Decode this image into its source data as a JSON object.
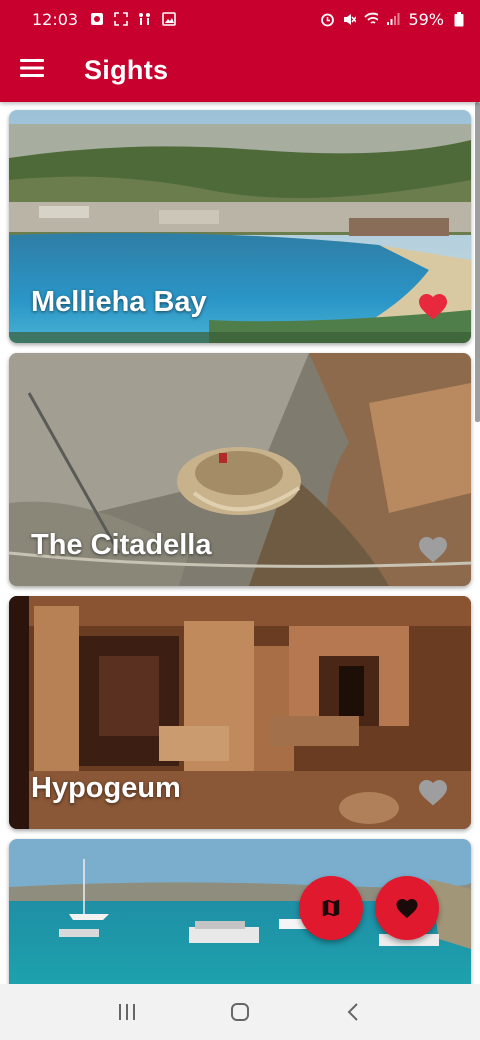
{
  "status_bar": {
    "time": "12:03",
    "battery": "59%",
    "left_icons": [
      "notification-icon",
      "screenshot-icon",
      "accessibility-icon",
      "gallery-icon"
    ],
    "right_icons": [
      "alarm-icon",
      "mute-icon",
      "wifi-icon",
      "signal-icon",
      "battery-icon"
    ]
  },
  "app_bar": {
    "title": "Sights",
    "menu_icon": "hamburger-menu-icon"
  },
  "sights": [
    {
      "name": "Mellieha Bay",
      "favorite": true
    },
    {
      "name": "The Citadella",
      "favorite": false
    },
    {
      "name": "Hypogeum",
      "favorite": false
    },
    {
      "name": "",
      "favorite": false
    }
  ],
  "fabs": [
    {
      "icon": "map-icon"
    },
    {
      "icon": "heart-icon"
    }
  ],
  "nav_bar": [
    "recents-icon",
    "home-icon",
    "back-icon"
  ],
  "colors": {
    "primary": "#c8002d",
    "accent": "#e0192f",
    "favorite_on": "#e8283c",
    "favorite_off": "#9e9e9e"
  }
}
